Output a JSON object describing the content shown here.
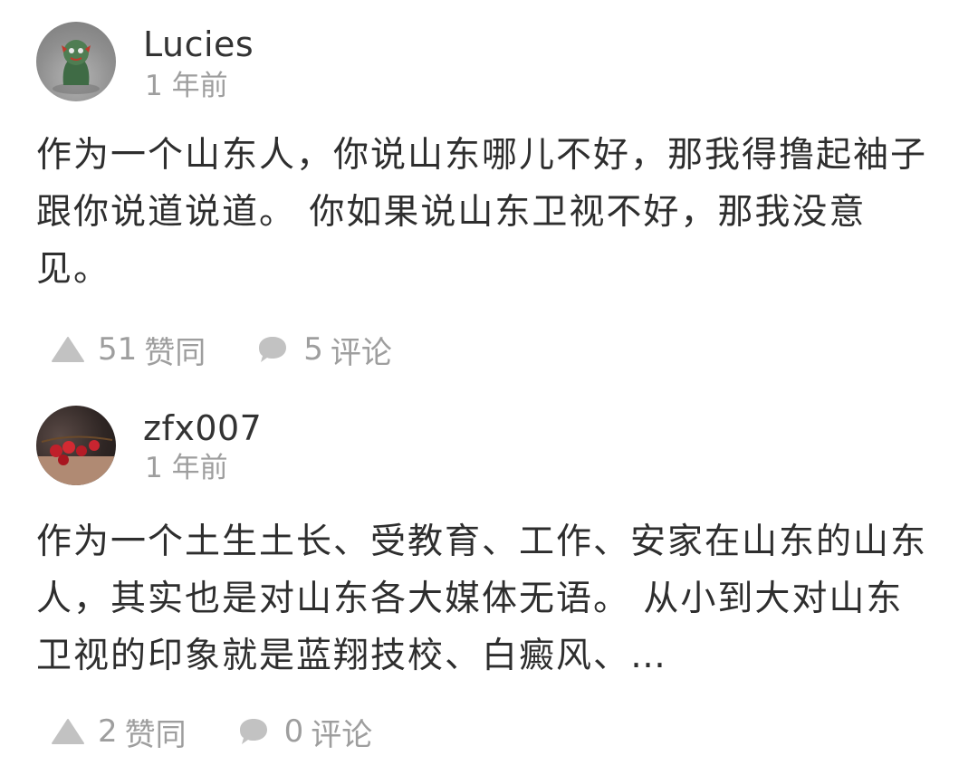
{
  "comments": [
    {
      "username": "Lucies",
      "time": "1 年前",
      "content": "作为一个山东人，你说山东哪儿不好，那我得撸起袖子跟你说道说道。 你如果说山东卫视不好，那我没意见。",
      "like_count": "51",
      "like_label": "赞同",
      "comment_count": "5",
      "comment_label": "评论"
    },
    {
      "username": "zfx007",
      "time": "1 年前",
      "content": "作为一个土生土长、受教育、工作、安家在山东的山东人，其实也是对山东各大媒体无语。 从小到大对山东卫视的印象就是蓝翔技校、白癜风、…",
      "like_count": "2",
      "like_label": "赞同",
      "comment_count": "0",
      "comment_label": "评论"
    }
  ],
  "colors": {
    "text": "#2e2e2e",
    "muted": "#9e9e9e",
    "icon": "#c2c2c2",
    "background": "#ffffff"
  },
  "icons": {
    "like": "upvote-triangle-icon",
    "comment": "speech-bubble-icon"
  }
}
